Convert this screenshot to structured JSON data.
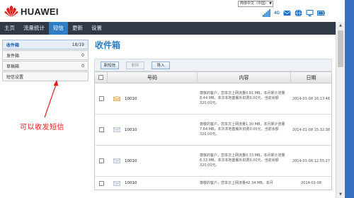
{
  "header": {
    "brand": "HUAWEI",
    "language": "简体中文（中国）",
    "network_label": "4G"
  },
  "nav": {
    "items": [
      "主页",
      "流量统计",
      "短信",
      "更新",
      "设置"
    ],
    "active_index": 2
  },
  "sidebar": {
    "items": [
      {
        "label": "收件箱",
        "count": "18/19"
      },
      {
        "label": "发件箱",
        "count": "0"
      },
      {
        "label": "草稿箱",
        "count": "0"
      },
      {
        "label": "短信设置",
        "count": ""
      }
    ]
  },
  "annotation": {
    "text": "可以收发短信",
    "color": "#e8201c"
  },
  "main": {
    "title": "收件箱",
    "toolbar": {
      "new_label": "新短信",
      "delete_label": "删除",
      "import_label": "导入"
    },
    "table": {
      "headers": [
        "号码",
        "内容",
        "日期"
      ],
      "rows": [
        {
          "number": "10010",
          "content": "尊敬的客户，您本次上网流量0.81 MB，本月累计流量8.44 MB，本次本地套餐外扣费0.00元，当前余额320.00元。",
          "date": "2014-01-08 16:13:46"
        },
        {
          "number": "10010",
          "content": "尊敬的客户，您本次上网流量1.30 MB，本月累计流量7.64 MB，本次本地套餐外扣费0.00元，当前余额320.00元。",
          "date": "2014-01-08 15:32:38"
        },
        {
          "number": "10010",
          "content": "尊敬的客户，您本次上网流量0.33 MB，本月累计流量6.33 MB，本次本地套餐外扣费0.00元，当前余额320.00元。",
          "date": "2014-01-08 12:55:27"
        },
        {
          "number": "10010",
          "content": "尊敬的客户，您本次上网流量42.34 MB，本月",
          "date": "2014-01-08"
        }
      ]
    }
  },
  "colors": {
    "nav_bg": "#2f3a46",
    "nav_active": "#2b7dc5",
    "accent": "#2b7dc5"
  }
}
